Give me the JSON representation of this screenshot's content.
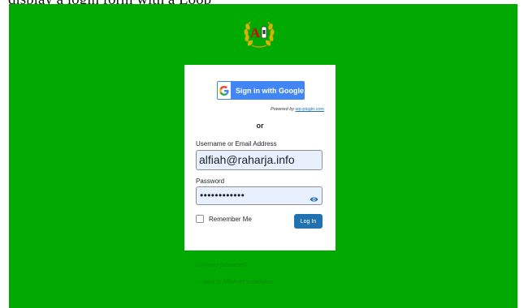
{
  "top_text": "display a login form with a Loop",
  "logo": {
    "text": "A",
    "icon": "laurel-wreath-logo"
  },
  "google_button": {
    "label": "Sign in with Google",
    "icon": "google-g-icon"
  },
  "powered": {
    "prefix": "Powered by",
    "link": "wp-plugin.com"
  },
  "separator": "or",
  "username": {
    "label": "Username or Email Address",
    "value": "alfiah@raharja.info"
  },
  "password": {
    "label": "Password",
    "value": "••••••••••••",
    "toggle_icon": "eye-icon"
  },
  "remember": {
    "label": "Remember Me",
    "checked": false
  },
  "login_button": {
    "label": "Log In"
  },
  "links": {
    "lost_password": "Lost your password?",
    "back_to_site": "← Back to Alfiahnet Installation"
  },
  "colors": {
    "background": "#00aa00",
    "primary": "#2271b1",
    "google_blue": "#4285f4",
    "field_bg": "#e8f0fe"
  }
}
